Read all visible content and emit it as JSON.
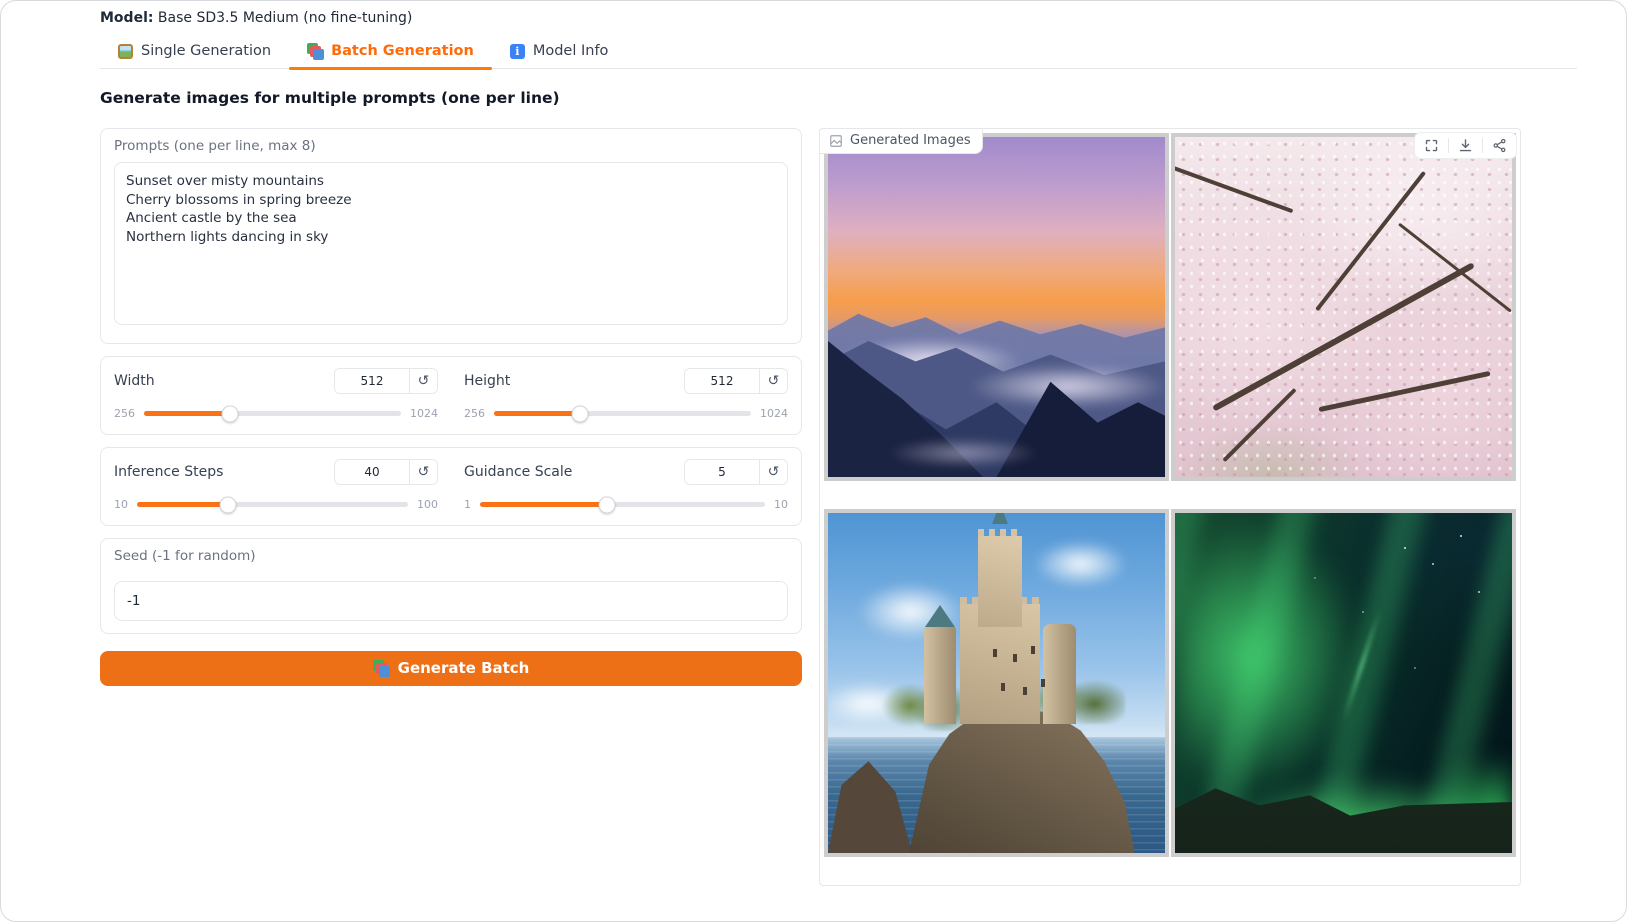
{
  "header": {
    "model_label": "Model:",
    "model_value": "Base SD3.5 Medium (no fine-tuning)"
  },
  "tabs": {
    "single": {
      "label": "Single Generation",
      "icon": "framed-picture-icon",
      "active": false
    },
    "batch": {
      "label": "Batch Generation",
      "icon": "layered-books-icon",
      "active": true
    },
    "info": {
      "label": "Model Info",
      "icon": "info-square-icon",
      "active": false
    }
  },
  "main": {
    "heading": "Generate images for multiple prompts (one per line)"
  },
  "prompts": {
    "label": "Prompts (one per line, max 8)",
    "value": "Sunset over misty mountains\nCherry blossoms in spring breeze\nAncient castle by the sea\nNorthern lights dancing in sky"
  },
  "sliders": {
    "width": {
      "label": "Width",
      "value": "512",
      "min": "256",
      "max": "1024",
      "fill_pct": 33.5
    },
    "height": {
      "label": "Height",
      "value": "512",
      "min": "256",
      "max": "1024",
      "fill_pct": 33.5
    },
    "steps": {
      "label": "Inference Steps",
      "value": "40",
      "min": "10",
      "max": "100",
      "fill_pct": 33.5
    },
    "guidance": {
      "label": "Guidance Scale",
      "value": "5",
      "min": "1",
      "max": "10",
      "fill_pct": 44.5
    }
  },
  "seed": {
    "label": "Seed (-1 for random)",
    "value": "-1"
  },
  "generate_button": {
    "label": "Generate Batch",
    "icon": "layered-books-icon"
  },
  "gallery": {
    "label": "Generated Images",
    "label_icon": "image-placeholder-icon",
    "toolbar_icons": [
      "fullscreen-icon",
      "download-icon",
      "share-icon"
    ],
    "images": [
      {
        "name": "sunset-over-misty-mountains"
      },
      {
        "name": "cherry-blossoms-in-spring-breeze"
      },
      {
        "name": "ancient-castle-by-the-sea"
      },
      {
        "name": "northern-lights-dancing-in-sky"
      }
    ]
  },
  "icons": {
    "reset_glyph": "↺"
  },
  "colors": {
    "accent_orange": "#f97316",
    "tab_active_orange": "#ff6b0b",
    "tab_underline": "#ff7c00",
    "button_orange": "#ee7016",
    "panel_border": "#e5e7eb",
    "thumb_frame": "#cdcdcd"
  }
}
